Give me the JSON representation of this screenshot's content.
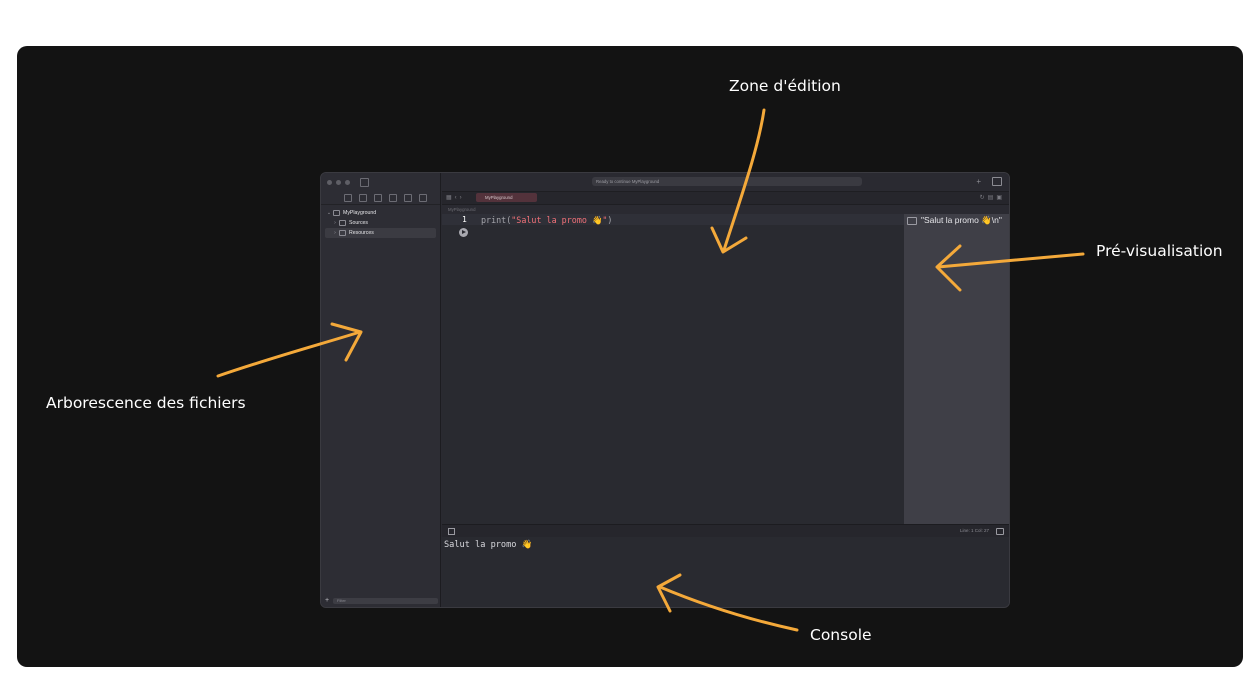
{
  "annotations": {
    "edit_zone": "Zone d'édition",
    "preview": "Pré-visualisation",
    "file_tree": "Arborescence des fichiers",
    "console": "Console",
    "arrow_color": "#F4A93A"
  },
  "window": {
    "status_text": "Ready to continue MyPlayground",
    "tab_label": "MyPlayground",
    "jump_bar": "MyPlayground",
    "sidebar": {
      "tree": [
        {
          "label": "MyPlayground",
          "chevron": "⌄",
          "icon": "swift-file-icon"
        },
        {
          "label": "Sources",
          "chevron": "›",
          "icon": "folder-icon"
        },
        {
          "label": "Resources",
          "chevron": "›",
          "icon": "folder-icon"
        }
      ],
      "add_symbol": "+",
      "filter_placeholder": "Filter"
    },
    "editor": {
      "line_number": "1",
      "code_prefix": "print(",
      "code_string": "\"Salut la promo 👋\"",
      "code_suffix": ")"
    },
    "preview": {
      "result": "\"Salut la promo 👋\\n\""
    },
    "debug_bar": {
      "position": "Line: 1  Col: 27"
    },
    "console": {
      "output": "Salut la promo 👋"
    },
    "colors": {
      "window_bg": "#2A2A31",
      "string": "#F07178",
      "active_tab": "#53323B"
    }
  }
}
